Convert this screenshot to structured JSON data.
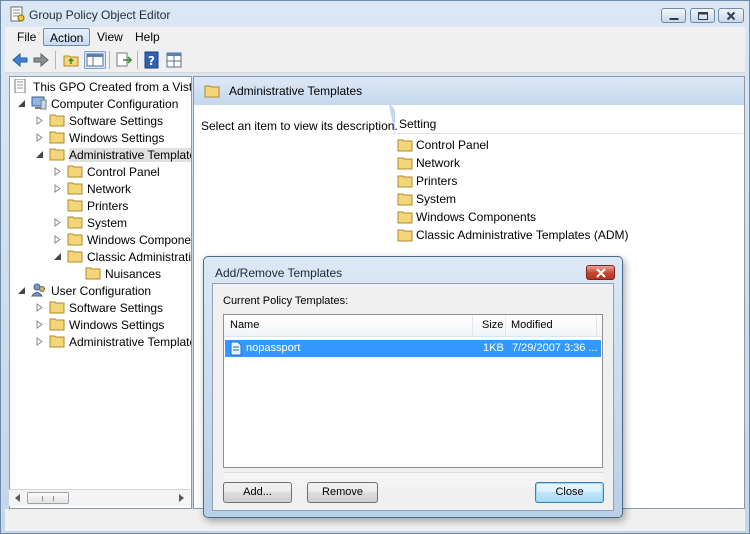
{
  "window": {
    "title": "Group Policy Object Editor"
  },
  "menu": {
    "file": "File",
    "action": "Action",
    "view": "View",
    "help": "Help"
  },
  "toolbar": {
    "icons": [
      "back-arrow-icon",
      "forward-arrow-icon",
      "up-folder-icon",
      "show-hide-tree-icon",
      "export-list-icon",
      "help-icon",
      "properties-icon"
    ]
  },
  "tree": {
    "root": "This GPO Created from a Vista M",
    "computer_config": "Computer Configuration",
    "cc_software": "Software Settings",
    "cc_windows": "Windows Settings",
    "cc_admin": "Administrative Templates",
    "cc_control_panel": "Control Panel",
    "cc_network": "Network",
    "cc_printers": "Printers",
    "cc_system": "System",
    "cc_windows_components": "Windows Components",
    "cc_classic": "Classic Administrative Templates",
    "cc_nuisances": "Nuisances",
    "user_config": "User Configuration",
    "uc_software": "Software Settings",
    "uc_windows": "Windows Settings",
    "uc_admin": "Administrative Templates"
  },
  "right_pane": {
    "header": "Administrative Templates",
    "description": "Select an item to view its description.",
    "column_setting": "Setting",
    "items": [
      "Control Panel",
      "Network",
      "Printers",
      "System",
      "Windows Components",
      "Classic Administrative Templates (ADM)"
    ]
  },
  "dialog": {
    "title": "Add/Remove Templates",
    "list_label": "Current Policy Templates:",
    "columns": {
      "name": "Name",
      "size": "Size",
      "modified": "Modified"
    },
    "rows": [
      {
        "name": "nopassport",
        "size": "1KB",
        "modified": "7/29/2007 3:36 ..."
      }
    ],
    "add_button": "Add...",
    "remove_button": "Remove",
    "close_button": "Close"
  },
  "colors": {
    "selection": "#3399ff",
    "pane_header": "#c4d7ee",
    "folder": "#f3d57a"
  }
}
